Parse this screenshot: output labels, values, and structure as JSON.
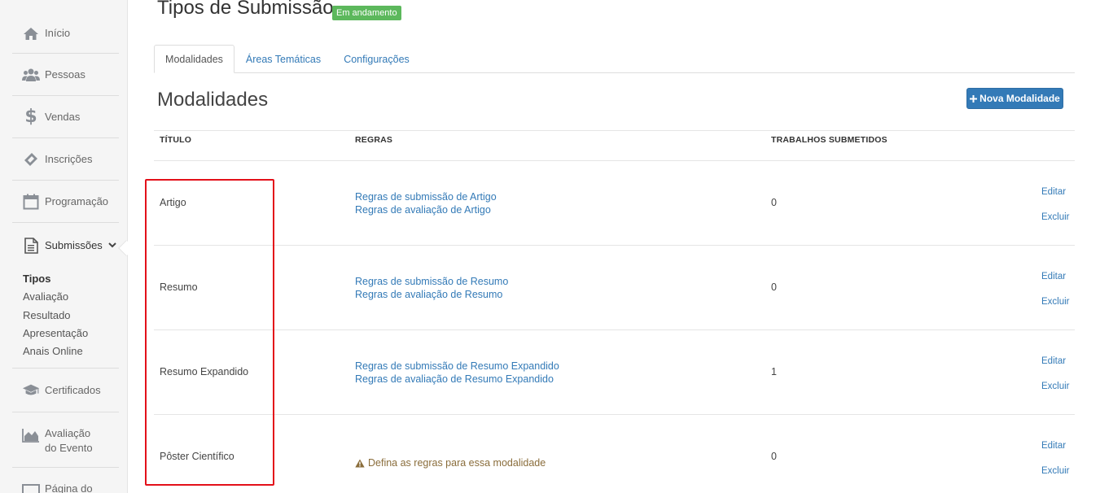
{
  "sidebar": {
    "items": [
      {
        "label": "Início",
        "icon": "home-icon"
      },
      {
        "label": "Pessoas",
        "icon": "people-icon"
      },
      {
        "label": "Vendas",
        "icon": "dollar-icon"
      },
      {
        "label": "Inscrições",
        "icon": "ticket-icon"
      },
      {
        "label": "Programação",
        "icon": "calendar-icon"
      },
      {
        "label": "Submissões",
        "icon": "document-icon"
      },
      {
        "label": "Certificados",
        "icon": "graduation-cap-icon"
      },
      {
        "label_line1": "Avaliação",
        "label_line2": "do Evento",
        "icon": "area-chart-icon"
      },
      {
        "label": "Página do",
        "icon": "window-icon"
      }
    ],
    "submenu": [
      "Tipos",
      "Avaliação",
      "Resultado",
      "Apresentação",
      "Anais Online"
    ]
  },
  "header": {
    "title": "Tipos de Submissão",
    "badge": "Em andamento",
    "badge_color": "#5cb85c"
  },
  "tabs": [
    {
      "label": "Modalidades",
      "active": true
    },
    {
      "label": "Áreas Temáticas",
      "active": false
    },
    {
      "label": "Configurações",
      "active": false
    }
  ],
  "main": {
    "section_title": "Modalidades",
    "new_button": "Nova Modalidade",
    "accent_color": "#337ab7",
    "columns": [
      "TÍTULO",
      "REGRAS",
      "TRABALHOS SUBMETIDOS"
    ],
    "rows": [
      {
        "title": "Artigo",
        "rule_submission": "Regras de submissão de Artigo",
        "rule_evaluation": "Regras de avaliação de Artigo",
        "count": "0",
        "edit": "Editar",
        "delete": "Excluir"
      },
      {
        "title": "Resumo",
        "rule_submission": "Regras de submissão de Resumo",
        "rule_evaluation": "Regras de avaliação de Resumo",
        "count": "0",
        "edit": "Editar",
        "delete": "Excluir"
      },
      {
        "title": "Resumo Expandido",
        "rule_submission": "Regras de submissão de Resumo Expandido",
        "rule_evaluation": "Regras de avaliação de Resumo Expandido",
        "count": "1",
        "edit": "Editar",
        "delete": "Excluir"
      },
      {
        "title": "Pôster Científico",
        "warning": "Defina as regras para essa modalidade",
        "count": "0",
        "edit": "Editar",
        "delete": "Excluir"
      }
    ]
  },
  "highlight_color": "#e3101a"
}
